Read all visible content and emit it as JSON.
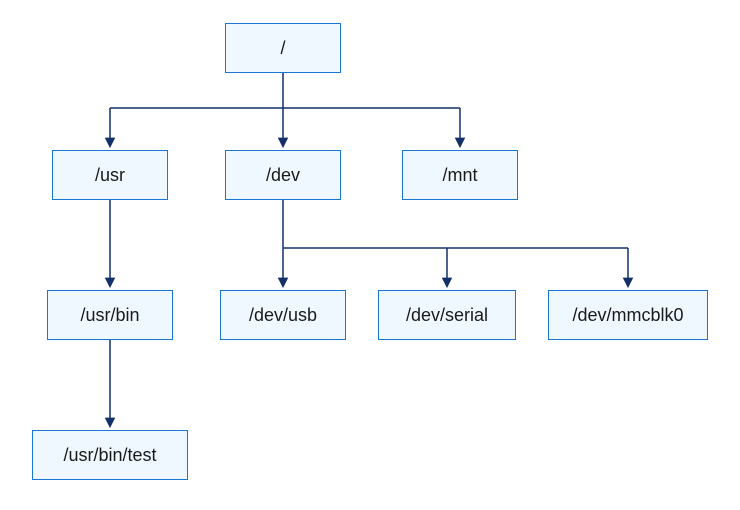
{
  "nodes": {
    "root": "/",
    "usr": "/usr",
    "dev": "/dev",
    "mnt": "/mnt",
    "usr_bin": "/usr/bin",
    "dev_usb": "/dev/usb",
    "dev_serial": "/dev/serial",
    "dev_mmcblk0": "/dev/mmcblk0",
    "usr_bin_test": "/usr/bin/test"
  },
  "colors": {
    "node_fill": "#f0f8ff",
    "node_border": "#1976d2",
    "connector": "#13306a"
  }
}
